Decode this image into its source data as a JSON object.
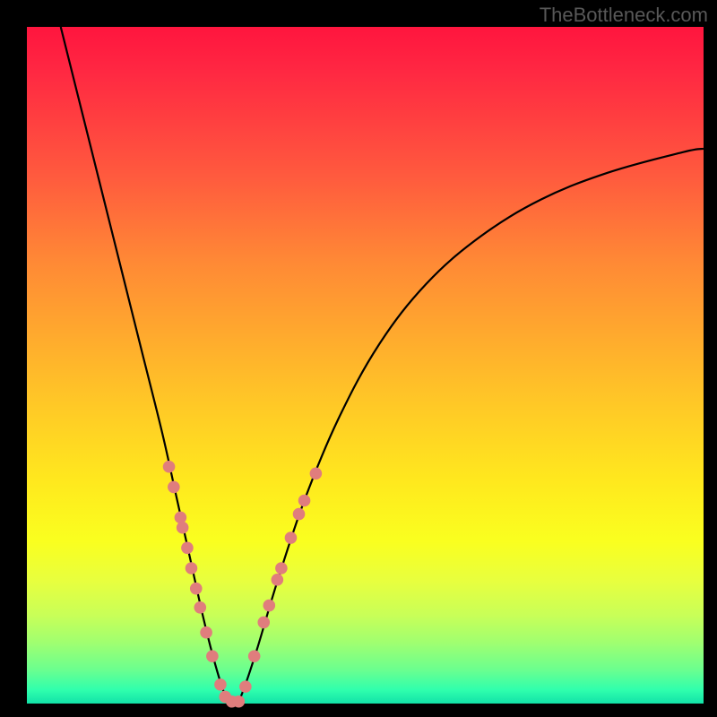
{
  "watermark": "TheBottleneck.com",
  "chart_data": {
    "type": "line",
    "title": "",
    "xlabel": "",
    "ylabel": "",
    "xlim": [
      0,
      100
    ],
    "ylim": [
      0,
      100
    ],
    "grid": false,
    "series": [
      {
        "name": "bottleneck-curve",
        "color": "#000000",
        "x": [
          5,
          8,
          11,
          14,
          17,
          20,
          22,
          24,
          26,
          27.5,
          29,
          30,
          31,
          32,
          34,
          37,
          41,
          46,
          52,
          59,
          67,
          76,
          86,
          97,
          100
        ],
        "y": [
          100,
          88,
          76,
          64,
          52,
          40,
          31,
          22,
          13,
          7,
          2,
          0,
          0,
          2,
          8,
          18,
          30,
          42,
          53,
          62,
          69,
          74.5,
          78.5,
          81.5,
          82
        ]
      }
    ],
    "markers": {
      "name": "highlight-dots",
      "color": "#e07d7d",
      "radius_pct": 0.9,
      "points": [
        {
          "x": 21.0,
          "y": 35.0
        },
        {
          "x": 21.7,
          "y": 32.0
        },
        {
          "x": 22.7,
          "y": 27.5
        },
        {
          "x": 23.0,
          "y": 26.0
        },
        {
          "x": 23.7,
          "y": 23.0
        },
        {
          "x": 24.3,
          "y": 20.0
        },
        {
          "x": 25.0,
          "y": 17.0
        },
        {
          "x": 25.6,
          "y": 14.2
        },
        {
          "x": 26.5,
          "y": 10.5
        },
        {
          "x": 27.4,
          "y": 7.0
        },
        {
          "x": 28.6,
          "y": 2.8
        },
        {
          "x": 29.3,
          "y": 1.0
        },
        {
          "x": 30.3,
          "y": 0.3
        },
        {
          "x": 31.3,
          "y": 0.3
        },
        {
          "x": 32.3,
          "y": 2.5
        },
        {
          "x": 33.6,
          "y": 7.0
        },
        {
          "x": 35.0,
          "y": 12.0
        },
        {
          "x": 35.8,
          "y": 14.5
        },
        {
          "x": 37.0,
          "y": 18.3
        },
        {
          "x": 37.6,
          "y": 20.0
        },
        {
          "x": 39.0,
          "y": 24.5
        },
        {
          "x": 40.2,
          "y": 28.0
        },
        {
          "x": 41.0,
          "y": 30.0
        },
        {
          "x": 42.7,
          "y": 34.0
        }
      ]
    }
  }
}
